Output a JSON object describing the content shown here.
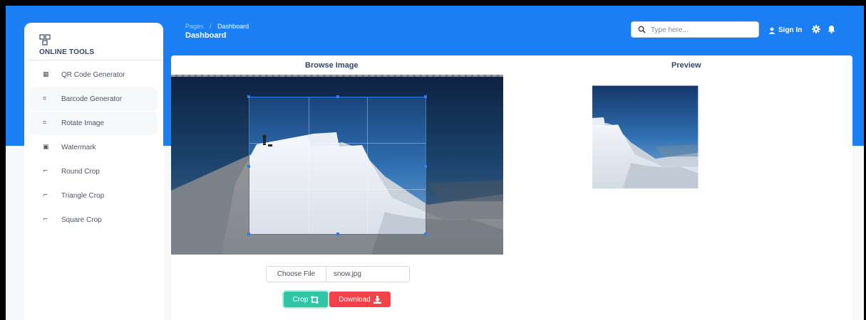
{
  "brand": {
    "name": "ONLINE TOOLS",
    "icon": "grid-app-icon"
  },
  "sidebar": {
    "items": [
      {
        "label": "QR Code Generator",
        "icon": "qrcode-icon",
        "active": false
      },
      {
        "label": "Barcode Generator",
        "icon": "barcode-icon",
        "active": true
      },
      {
        "label": "Rotate Image",
        "icon": "rotate-icon",
        "active": true
      },
      {
        "label": "Watermark",
        "icon": "watermark-icon",
        "active": false
      },
      {
        "label": "Round Crop",
        "icon": "crop-icon",
        "active": false
      },
      {
        "label": "Triangle Crop",
        "icon": "crop-icon",
        "active": false
      },
      {
        "label": "Square Crop",
        "icon": "crop-icon",
        "active": false
      }
    ]
  },
  "header": {
    "breadcrumb": [
      "Pages",
      "Dashboard"
    ],
    "title": "Dashboard",
    "search_placeholder": "Type here...",
    "signin_label": "Sign In"
  },
  "main": {
    "browse_title": "Browse Image",
    "preview_title": "Preview",
    "file_button_label": "Choose File",
    "file_name": "snow.jpg",
    "crop_label": "Crop",
    "download_label": "Download"
  },
  "colors": {
    "header_blue": "#1a7ff5",
    "crop_button": "#2fc5a5",
    "download_button": "#f5424a",
    "crop_frame": "#2f7fe3"
  }
}
